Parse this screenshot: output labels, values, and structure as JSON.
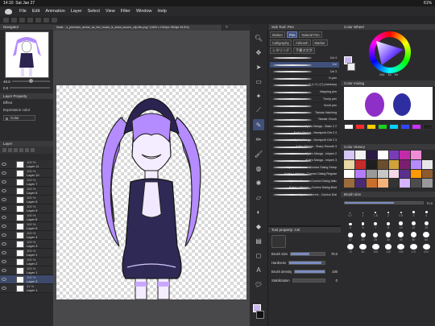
{
  "status": {
    "time": "14:10",
    "date": "Sat Jan 27",
    "battery": "61%"
  },
  "menu": [
    "File",
    "Edit",
    "Animation",
    "Layer",
    "Select",
    "View",
    "Filter",
    "Window",
    "Help"
  ],
  "document": {
    "tab_title": "Illustr....s_pheniam_anime_as_the_hooks_is_kuba_kusem_clip-file.png* (1800 x 1940px 350dpi 49.8%)"
  },
  "navigator": {
    "title": "Navigator",
    "zoom": "49.8",
    "rotation": "0.0"
  },
  "layer_property": {
    "title": "Layer Property",
    "effect_label": "Effect",
    "expression_label": "Expression color",
    "expression_value": "Color"
  },
  "layers": {
    "title": "Layer",
    "items": [
      {
        "pct": "100 %",
        "name": "Layer 11"
      },
      {
        "pct": "100 %",
        "name": "Layer 10"
      },
      {
        "pct": "100 %",
        "name": "Layer 7"
      },
      {
        "pct": "100 %",
        "name": "Layer 6"
      },
      {
        "pct": "100 %",
        "name": "Layer 5"
      },
      {
        "pct": "100 %",
        "name": "Layer 9"
      },
      {
        "pct": "100 %",
        "name": "Layer 8"
      },
      {
        "pct": "100 %",
        "name": "Layer 5"
      },
      {
        "pct": "100 %",
        "name": "Layer 4"
      },
      {
        "pct": "100 %",
        "name": "Layer 3"
      },
      {
        "pct": "100 %",
        "name": "Layer 1"
      },
      {
        "pct": "100 %",
        "name": "Layer 2"
      },
      {
        "pct": "100 %",
        "name": "Layer 1"
      },
      {
        "pct": "100 %",
        "name": "Layer 3"
      },
      {
        "pct": "41 %",
        "name": "Layer 1"
      }
    ]
  },
  "subtool": {
    "title": "Sub Tool: Pen",
    "tabs": [
      "Marker",
      "Pen",
      "Natural Pen",
      "Calligraphy",
      "Airbrush",
      "Marker",
      "レタリング",
      "手書き文字"
    ],
    "brushes": [
      "Cel 4",
      "Cel",
      "Cel 3",
      "G-pen",
      "ミリペン(?) (mechaxy",
      "Mapping pen",
      "Turnip pen",
      "Scroll pen",
      "Tabular Hatching",
      "Tabular Chunk",
      "Kyle's Manga - Basic 2 2",
      "Kyle's Manga - Newsprint Dirt 2 3",
      "Kyle's Manga - Newsprint Dirt 2 3",
      "Kyle's Manga - Sharp Smooth 3",
      "Kyle's Manga - Inkpen 2",
      "Kyle's Manga - Inkpen 3",
      "Kyle's Letterers - Comics Dialog Sharp",
      "Kyle's Letterers - Comics Dialog Regular",
      "Kyle's Letterers - Comics Dialog Italic",
      "Kyle's Letterers - Comics Dialog Bold",
      "Kyle's Letterers - Comics Dial"
    ]
  },
  "tool_property": {
    "title": "Tool property: Cel",
    "rows": [
      {
        "label": "Brush Size",
        "value": "70.0",
        "fill": 0.55
      },
      {
        "label": "Hardness",
        "value": "",
        "fill": 0.9
      },
      {
        "label": "Brush density",
        "value": "100",
        "fill": 1.0
      },
      {
        "label": "Stabilization",
        "value": "0",
        "fill": 0.0
      }
    ]
  },
  "color_wheel": {
    "title": "Color Wheel",
    "h": "204",
    "s": "16",
    "v": "94"
  },
  "color_mixing": {
    "title": "Color mixing"
  },
  "color_history": {
    "title": "Color History"
  },
  "brush_size": {
    "title": "Brush size",
    "value": "70.0",
    "labels": [
      "0.7",
      "1",
      "1.5",
      "2",
      "2.5",
      "3",
      "4",
      "5",
      "6",
      "7",
      "8",
      "10",
      "12",
      "15",
      "17",
      "20",
      "25",
      "30",
      "40",
      "50",
      "60",
      "70",
      "80",
      "100",
      "120",
      "150",
      "170",
      "200"
    ]
  },
  "colors": {
    "fg": "#c9b6ee",
    "palette": [
      "#ffffff",
      "#ff2a2a",
      "#ffcc00",
      "#1ad11a",
      "#00d0ff",
      "#3344ff",
      "#cc33ff",
      "#222222"
    ],
    "history": [
      "#d5c6f5",
      "#f1f1f1",
      "#2a1c44",
      "#ffffff",
      "#7b3bb8",
      "#c32aa9",
      "#f08bd6",
      "#2d2d2d",
      "#ead8a4",
      "#c42b2b",
      "#1e1e1e",
      "#6b4e2e",
      "#d1a23a",
      "#7a1f6f",
      "#b58cff",
      "#e7e7e7",
      "#ffffff",
      "#b67cff",
      "#9a9a9a",
      "#c7c7c7",
      "#f4d7e8",
      "#5b2f8f",
      "#ff9900",
      "#8c5b2e",
      "#9c6b3b",
      "#4a2a73",
      "#c96f2d",
      "#f3b27a",
      "#333333",
      "#d4b3ff",
      "#4c4c4c",
      "#999999"
    ]
  }
}
